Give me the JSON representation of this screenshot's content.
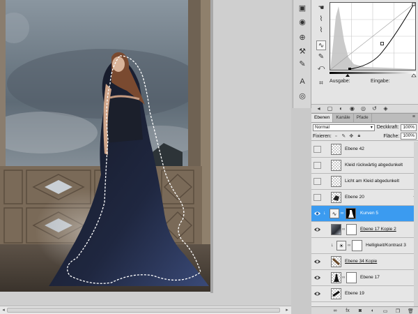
{
  "curves": {
    "output_label": "Ausgabe:",
    "input_label": "Eingabe:",
    "curve_tools": [
      "hand-icon",
      "eyedropper-black-icon",
      "eyedropper-gray-icon",
      "eyedropper-white-icon",
      "curve-icon",
      "pencil-icon",
      "smooth-icon"
    ]
  },
  "layers": {
    "tabs": [
      "Ebenen",
      "Kanäle",
      "Pfade"
    ],
    "blend_mode": "Normal",
    "opacity_label": "Deckkraft:",
    "opacity_value": "100%",
    "lock_label": "Fixieren:",
    "fill_label": "Fläche:",
    "fill_value": "100%",
    "items": [
      {
        "name": "Ebene 42"
      },
      {
        "name": "Kleid rückwärtig abgedunkelt"
      },
      {
        "name": "Licht am Kleid abgedunkelt"
      },
      {
        "name": "Ebene 20"
      },
      {
        "name": "Kurven 5"
      },
      {
        "name": "Ebene 17 Kopie 2"
      },
      {
        "name": "Helligkeit/Kontrast 3"
      },
      {
        "name": "Ebene 34 Kopie"
      },
      {
        "name": "Ebene 17"
      },
      {
        "name": "Ebene 19"
      }
    ]
  },
  "colors": {
    "selected_layer": "#3b9bf0",
    "panel_bg": "#e6e6e6",
    "canvas_sky": "#6c7780"
  }
}
